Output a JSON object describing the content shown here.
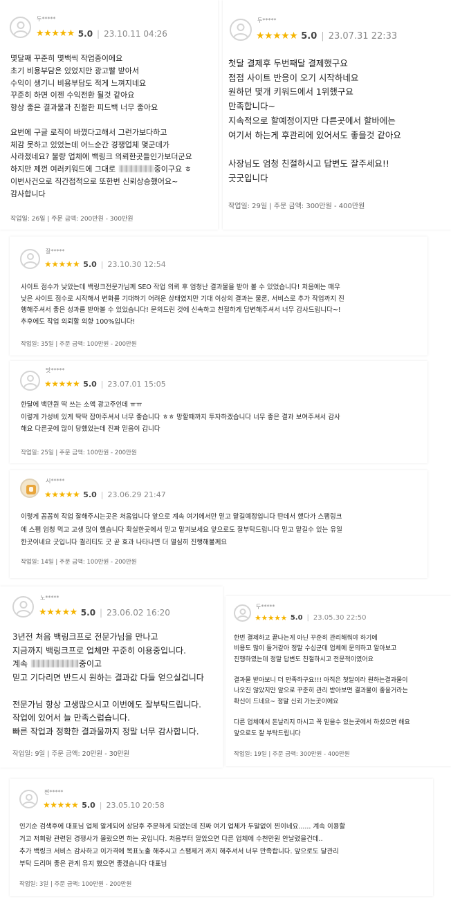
{
  "reviews": [
    {
      "nickname": "두*****",
      "stars": "★★★★★",
      "score": "5.0",
      "separator": "|",
      "date": "23.10.11 04:26",
      "body_a": "몇달째 꾸준히 몇백씩 작업중이에요\n초기 비용부담은 있었지만 광고빨 받아서\n수익이 생기니 비용부담도 적게 느껴지네요\n꾸준히 하면 이젠 수익전환 될것 같아요\n항상 좋은 결과물과 친절한 피드백 너무 좋아요\n\n요번에 구글 로직이 바꼈다고해서 그런가보다하고\n체감 못하고 있었는데 어느순간 경쟁업체 몇군데가\n사라졌네요? 불량 업체에 백링크 의뢰한곳들인가보더군요\n하지만 제껀 여러키워드에 그대로 ",
      "body_b": "중이구요 ㅎ\n이번사건으로 직간접적으로 또한번 신뢰상승했어요~\n감사합니다",
      "meta": "작업일: 26일 | 주문 금액: 200만원 - 300만원"
    },
    {
      "nickname": "두*****",
      "stars": "★★★★★",
      "score": "5.0",
      "separator": "|",
      "date": "23.07.31 22:33",
      "body": "첫달 결제후 두번째달 결제했구요\n점점 사이트 반응이 오기 시작하네요\n원하던 몇개 키워드에서 1위했구요\n만족합니다~\n지속적으로 할예정이지만 다른곳에서 할바에는\n여기서 하는게 후관리에 있어서도 좋을것 같아요\n\n사장님도 엄청 친절하시고 답변도 잘주세요!!\n굿굿입니다",
      "meta": "작업일: 29일 | 주문 금액: 300만원 - 400만원"
    },
    {
      "nickname": "잘*****",
      "stars": "★★★★★",
      "score": "5.0",
      "separator": "|",
      "date": "23.10.30 12:54",
      "body": "사이트 점수가 낮았는데 백링크전문가님께 SEO 작업 의뢰 후 엄청난 결과물을 받아 볼 수 있었습니다! 처음에는 매우\n낮은 사이트 점수로 시작해서 변화를 기대하기 어려운 상태였지만 기대 이상의 결과는 물론, 서비스로 추가 작업까지 진\n행해주셔서 좋은 성과를 받아볼 수 있었습니다! 문의드린 것에 신속하고 친절하게 답변해주셔서 너무 감사드립니다~!\n추후에도 작업 의뢰할 의향 100%입니다!",
      "meta": "작업일: 35일 | 주문 금액: 100만원 - 200만원"
    },
    {
      "nickname": "맛*****",
      "stars": "★★★★★",
      "score": "5.0",
      "separator": "|",
      "date": "23.07.01 15:05",
      "body": "한달에 백만원 딱 쓰는 소액 광고주인데 ㅠㅠ\n이렇게 가성비 있게 딱딱 잡아주셔서 너무 좋습니다 ㅎㅎ 망할때까지 투자하겠습니다 너무 좋은 결과 보여주셔서 감사\n해요 다른곳에 많이 당했었는데 진짜 믿음이 갑니다",
      "meta": "작업일: 25일 | 주문 금액: 100만원 - 200만원"
    },
    {
      "nickname": "시*****",
      "stars": "★★★★★",
      "score": "5.0",
      "separator": "|",
      "date": "23.06.29 21:47",
      "body": "이렇게 꼼꼼히 작업 잘해주시는곳은 처음입니다 앞으로 계속 여기에서만 믿고 맡길예정입니다 딴데서 했다가 스팸링크\n에 스팸 엄청 먹고 고생 많이 했습니다 확실한곳에서 믿고 맡겨보세요 앞으로도 잘부탁드립니다 믿고 맡길수 있는 유일\n한곳이네요 굿입니다 퀄리티도 굿 곧 효과 나타나면 더 열심히 진행해볼께요",
      "meta": "작업일: 14일 | 주문 금액: 100만원 - 200만원"
    },
    {
      "nickname": "노*****",
      "stars": "★★★★★",
      "score": "5.0",
      "separator": "|",
      "date": "23.06.02 16:20",
      "body_a": "3년전 처음 백링크프로 전문가님을 만나고\n지금까지 백링크프로 업체만 꾸준히 이용중입니다.\n계속 ",
      "body_b": "중이고\n믿고 기다리면 반드시 원하는 결과값 다들 얻으실겁니다\n\n전문가님 항상 고생많으시고 이번에도 잘부탁드립니다.\n작업에 있어서 늘 만족스럽습니다.\n빠른 작업과 정확한 결과물까지 정말 너무 감사합니다.",
      "meta": "작업일: 9일 | 주문 금액: 20만원 - 30만원"
    },
    {
      "nickname": "두*****",
      "stars": "★★★★★",
      "score": "5.0",
      "separator": "|",
      "date": "23.05.30 22:50",
      "body": "한번 결제하고 끝나는게 아닌 꾸준히 관리해줘야 하기에\n비용도 많이 들거같아 정말 수십군데 업체에 문의하고 알아보고\n진행하였는데 정말 답변도 친절하시고 전문적이였어요\n\n결과물 받아보니 더 만족하구요!!! 아직은 첫달이라 원하는결과물이\n나오진 않았지만 앞으로 꾸준히 관리 받아보면 결과물이 좋을거라는\n확신이 드네요~ 정말 신뢰 가는곳이에요\n\n다른 업체에서 돈날리지 마시고 꼭 믿을수 있는곳에서 하셨으면 해요\n앞으로도 잘 부탁드립니다",
      "meta": "작업일: 19일 | 주문 금액: 300만원 - 400만원"
    },
    {
      "nickname": "찐*****",
      "stars": "★★★★★",
      "score": "5.0",
      "separator": "|",
      "date": "23.05.10 20:58",
      "body": "인기순 검색후에 대표님 업체 알게되어 상담후 주문하게 되었는데 진짜 여기 업체가 두말없이 찐이네요...... 계속 이용할\n거고 저희랑 관련된 경쟁사가 몰랐으면 하는 곳입니다. 처음부터 알았으면 다른 업체에 수천만원 안날렸을건데..\n추가 백링크 서비스 감사하고 이가격에 목표노출 해주시고 스팸제거 까지 해주셔서 너무 만족합니다. 앞으로도 달관리\n부탁 드리며 좋은 관계 유지 했으면 좋겠습니다 대표님",
      "meta": "작업일: 3일 | 주문 금액: 100만원 - 200만원"
    }
  ]
}
